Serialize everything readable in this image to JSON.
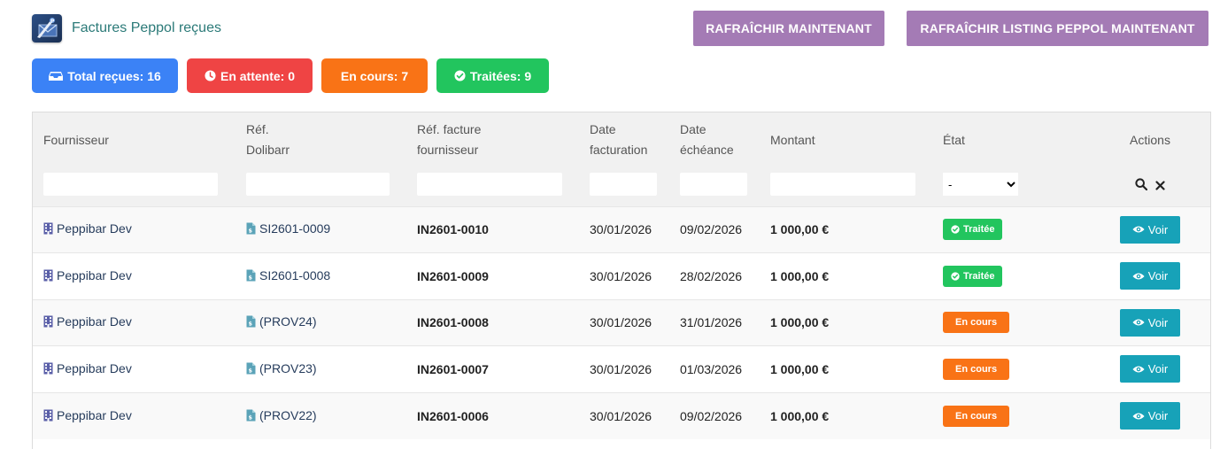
{
  "header": {
    "title": "Factures Peppol reçues",
    "refresh_label": "RAFRAÎCHIR MAINTENANT",
    "refresh_listing_label": "RAFRAÎCHIR LISTING PEPPOL MAINTENANT"
  },
  "badges": {
    "total": "Total reçues: 16",
    "pending": "En attente: 0",
    "progress": "En cours: 7",
    "done": "Traitées: 9"
  },
  "colors": {
    "blue": "#3b82f6",
    "red": "#ef4444",
    "orange": "#f97316",
    "green": "#22c55e",
    "purple": "#a47bb5",
    "teal": "#17a2b8"
  },
  "table": {
    "columns": {
      "supplier": "Fournisseur",
      "ref_dolibarr_1": "Réf.",
      "ref_dolibarr_2": "Dolibarr",
      "ref_supplier_1": "Réf. facture",
      "ref_supplier_2": "fournisseur",
      "date_invoice_1": "Date",
      "date_invoice_2": "facturation",
      "date_due_1": "Date",
      "date_due_2": "échéance",
      "amount": "Montant",
      "state": "État",
      "actions": "Actions"
    },
    "state_filter_selected": "-",
    "view_label": "Voir",
    "rows": [
      {
        "supplier": "Peppibar Dev",
        "ref": "SI2601-0009",
        "ref_supplier": "IN2601-0010",
        "date": "30/01/2026",
        "due": "09/02/2026",
        "amount": "1 000,00 €",
        "state": "Traitée",
        "state_type": "done"
      },
      {
        "supplier": "Peppibar Dev",
        "ref": "SI2601-0008",
        "ref_supplier": "IN2601-0009",
        "date": "30/01/2026",
        "due": "28/02/2026",
        "amount": "1 000,00 €",
        "state": "Traitée",
        "state_type": "done"
      },
      {
        "supplier": "Peppibar Dev",
        "ref": "(PROV24)",
        "ref_supplier": "IN2601-0008",
        "date": "30/01/2026",
        "due": "31/01/2026",
        "amount": "1 000,00 €",
        "state": "En cours",
        "state_type": "progress"
      },
      {
        "supplier": "Peppibar Dev",
        "ref": "(PROV23)",
        "ref_supplier": "IN2601-0007",
        "date": "30/01/2026",
        "due": "01/03/2026",
        "amount": "1 000,00 €",
        "state": "En cours",
        "state_type": "progress"
      },
      {
        "supplier": "Peppibar Dev",
        "ref": "(PROV22)",
        "ref_supplier": "IN2601-0006",
        "date": "30/01/2026",
        "due": "09/02/2026",
        "amount": "1 000,00 €",
        "state": "En cours",
        "state_type": "progress"
      }
    ]
  }
}
